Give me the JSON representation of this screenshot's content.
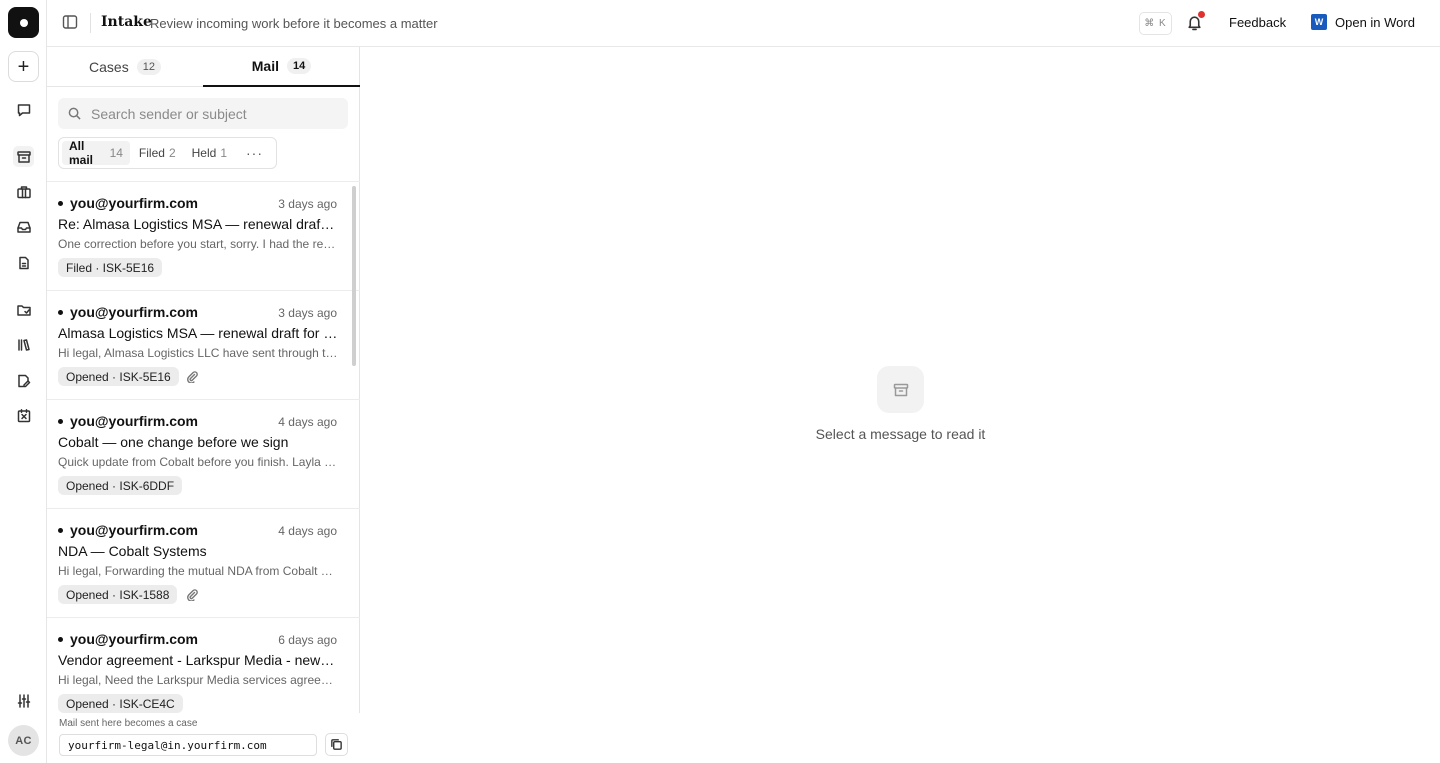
{
  "topbar": {
    "title": "Intake",
    "subtitle": "Review incoming work before it becomes a matter",
    "shortcut": "⌘ K",
    "feedback_label": "Feedback",
    "open_word_label": "Open in Word",
    "word_icon_glyph": "W"
  },
  "rail": {
    "new_glyph": "+",
    "avatar_initials": "AC"
  },
  "tabs": [
    {
      "label": "Cases",
      "count": "12"
    },
    {
      "label": "Mail",
      "count": "14"
    }
  ],
  "search": {
    "placeholder": "Search sender or subject",
    "value": ""
  },
  "filters": [
    {
      "label": "All mail",
      "count": "14"
    },
    {
      "label": "Filed",
      "count": "2"
    },
    {
      "label": "Held",
      "count": "1"
    }
  ],
  "filters_more": "···",
  "messages": [
    {
      "sender": "you@yourfirm.com",
      "time": "3 days ago",
      "subject": "Re: Almasa Logistics MSA — renewal draft for review",
      "preview": "One correction before you start, sorry. I had the renewal term wrong in my last note.",
      "badge": "Filed · ISK-5E16",
      "attachment": false
    },
    {
      "sender": "you@yourfirm.com",
      "time": "3 days ago",
      "subject": "Almasa Logistics MSA — renewal draft for review",
      "preview": "Hi legal, Almasa Logistics LLC have sent through their renewal draft of the MSA.",
      "badge": "Opened · ISK-5E16",
      "attachment": true
    },
    {
      "sender": "you@yourfirm.com",
      "time": "4 days ago",
      "subject": "Cobalt — one change before we sign",
      "preview": "Quick update from Cobalt before you finish. Layla asked about the liability cap.",
      "badge": "Opened · ISK-6DDF",
      "attachment": false
    },
    {
      "sender": "you@yourfirm.com",
      "time": "4 days ago",
      "subject": "NDA — Cobalt Systems",
      "preview": "Hi legal, Forwarding the mutual NDA from Cobalt Systems for review.",
      "badge": "Opened · ISK-1588",
      "attachment": true
    },
    {
      "sender": "you@yourfirm.com",
      "time": "6 days ago",
      "subject": "Vendor agreement - Larkspur Media - new services",
      "preview": "Hi legal, Need the Larkspur Media services agreement reviewed this week.",
      "badge": "Opened · ISK-CE4C",
      "attachment": false
    }
  ],
  "footer": {
    "label": "Mail sent here becomes a case",
    "address": "yourfirm-legal@in.yourfirm.com"
  },
  "reader": {
    "empty_text": "Select a message to read it"
  }
}
